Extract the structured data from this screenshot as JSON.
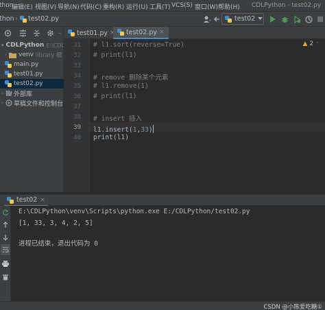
{
  "menu": {
    "partial_left": "thon",
    "items": [
      "编辑(E)",
      "视图(V)",
      "导航(N)",
      "代码(C)",
      "重构(R)",
      "运行(U)",
      "工具(T)",
      "VCS(S)",
      "窗口(W)",
      "帮助(H)"
    ],
    "window_title": "CDLPython - test02.py"
  },
  "breadcrumb": {
    "project": "thon",
    "file": "test02.py"
  },
  "run_config": {
    "label": "test02"
  },
  "project_panel": {
    "rows": [
      {
        "label": "CDLPython",
        "hint": "E:\\CDLPyth",
        "icon": "folder-icon",
        "bold": true
      },
      {
        "label": "venv",
        "hint": "library 根",
        "icon": "folder-icon"
      },
      {
        "label": "main.py",
        "hint": "",
        "icon": "python-file-icon"
      },
      {
        "label": "test01.py",
        "hint": "",
        "icon": "python-file-icon"
      },
      {
        "label": "test02.py",
        "hint": "",
        "icon": "python-file-icon",
        "selected": true
      },
      {
        "label": "外部库",
        "hint": "",
        "icon": "library-icon"
      },
      {
        "label": "草稿文件和控制台",
        "hint": "",
        "icon": "scratch-icon"
      }
    ]
  },
  "editor_tabs": [
    {
      "label": "test01.py",
      "active": false
    },
    {
      "label": "test02.py",
      "active": true
    }
  ],
  "editor": {
    "warnings": "2",
    "lines": [
      {
        "num": "31",
        "text": "# l1.sort(reverse=True)",
        "kind": "comment"
      },
      {
        "num": "32",
        "text": "# print(l1)",
        "kind": "comment"
      },
      {
        "num": "33",
        "text": "",
        "kind": "plain"
      },
      {
        "num": "34",
        "text": "# remove 删除某个元素",
        "kind": "comment"
      },
      {
        "num": "35",
        "text": "# l1.remove(1)",
        "kind": "comment"
      },
      {
        "num": "36",
        "text": "# print(l1)",
        "kind": "comment"
      },
      {
        "num": "37",
        "text": "",
        "kind": "plain"
      },
      {
        "num": "38",
        "text": "# insert 插入",
        "kind": "comment"
      },
      {
        "num": "39",
        "text": "l1.insert(1,33)",
        "kind": "insert",
        "current": true
      },
      {
        "num": "40",
        "text": "print(l1)",
        "kind": "plain"
      }
    ]
  },
  "run_panel": {
    "tab_label": "test02",
    "console": [
      "E:\\CDLPython\\venv\\Scripts\\python.exe E:/CDLPython/test02.py",
      "[1, 33, 3, 4, 2, 5]",
      "",
      "进程已结束，退出代码为 0"
    ]
  },
  "watermark": "CSDN @小陈爱吃糖①",
  "colors": {
    "accent": "#4a88c7",
    "run_green": "#499c54",
    "python_blue": "#3c8dd6",
    "python_yellow": "#f0c94a"
  }
}
